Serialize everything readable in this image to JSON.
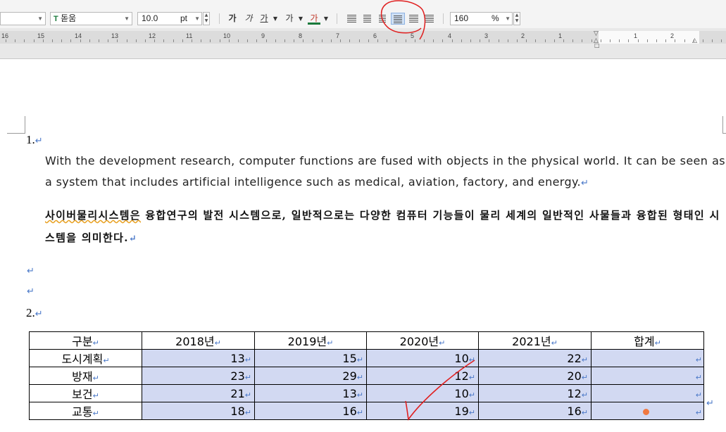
{
  "toolbar": {
    "font_name": "돋움",
    "font_size": "10.0",
    "font_unit": "pt",
    "bold_label": "가",
    "italic_label": "가",
    "underline_label": "가",
    "strike_label": "가",
    "color_label": "가",
    "zoom_value": "160",
    "zoom_unit": "%",
    "accent_color": "#8db2e3"
  },
  "ruler": {
    "numbers": [
      "16",
      "15",
      "14",
      "13",
      "12",
      "11",
      "10",
      "9",
      "8",
      "7",
      "6",
      "5",
      "4",
      "3",
      "2",
      "1",
      "1",
      "2"
    ]
  },
  "document": {
    "item1_number": "1.",
    "paragraph_en": "With the development research, computer functions are fused with objects in the physical world. It can be seen as a system that includes artificial intelligence such as medical, aviation, factory, and energy.",
    "paragraph_ko_underlined": "사이버물리시스템은",
    "paragraph_ko_rest": " 융합연구의 발전 시스템으로, 일반적으로는 다양한 컴퓨터 기능들이 물리 세계의 일반적인 사물들과 융합된 형태인 시스템을 의미한다.",
    "item2_number": "2.",
    "paragraph_mark": "↵"
  },
  "table": {
    "headers": [
      "구분",
      "2018년",
      "2019년",
      "2020년",
      "2021년",
      "합계"
    ],
    "rows": [
      {
        "label": "도시계획",
        "values": [
          "13",
          "15",
          "10",
          "22"
        ],
        "total": ""
      },
      {
        "label": "방재",
        "values": [
          "23",
          "29",
          "12",
          "20"
        ],
        "total": ""
      },
      {
        "label": "보건",
        "values": [
          "21",
          "13",
          "10",
          "12"
        ],
        "total": ""
      },
      {
        "label": "교통",
        "values": [
          "18",
          "16",
          "19",
          "16"
        ],
        "total": ""
      }
    ],
    "selection_color": "#d2d9f2"
  },
  "annotations": {
    "ink_color": "#e02020"
  }
}
